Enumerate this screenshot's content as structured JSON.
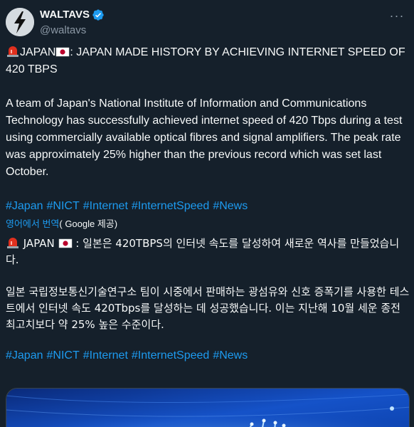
{
  "author": {
    "display_name": "WALTAVS",
    "handle": "@waltavs",
    "verified": true,
    "avatar_icon": "lightning-bolt-icon"
  },
  "menu_icon": "more-dots-icon",
  "tweet": {
    "headline_pre": "JAPAN",
    "headline_post": ": JAPAN MADE HISTORY BY ACHIEVING INTERNET SPEED OF 420 TBPS",
    "body": "A team of Japan's National Institute of Information and Communications Technology has successfully achieved internet speed of 420 Tbps during a test using commercially available optical fibres and signal amplifiers. The peak rate was approximately 25% higher than the previous record which was set last October.",
    "hashtags": [
      "#Japan",
      "#NICT",
      "#Internet",
      "#InternetSpeed",
      "#News"
    ]
  },
  "translation": {
    "label_from": "영어에서 번역",
    "label_by": "( Google 제공)",
    "headline_pre": " JAPAN ",
    "headline_post": " : 일본은 420TBPS의 인터넷 속도를 달성하여 새로운 역사를 만들었습니다.",
    "body": "일본 국립정보통신기술연구소 팀이 시중에서 판매하는 광섬유와 신호 증폭기를 사용한 테스트에서 인터넷 속도 420Tbps를 달성하는 데 성공했습니다. 이는 지난해 10월 세운 종전 최고치보다 약 25% 높은 수준이다.",
    "hashtags": [
      "#Japan",
      "#NICT",
      "#Internet",
      "#InternetSpeed",
      "#News"
    ]
  },
  "colors": {
    "background": "#15202b",
    "text": "#f7f9f9",
    "secondary": "#8b98a5",
    "accent": "#1d9bf0"
  }
}
